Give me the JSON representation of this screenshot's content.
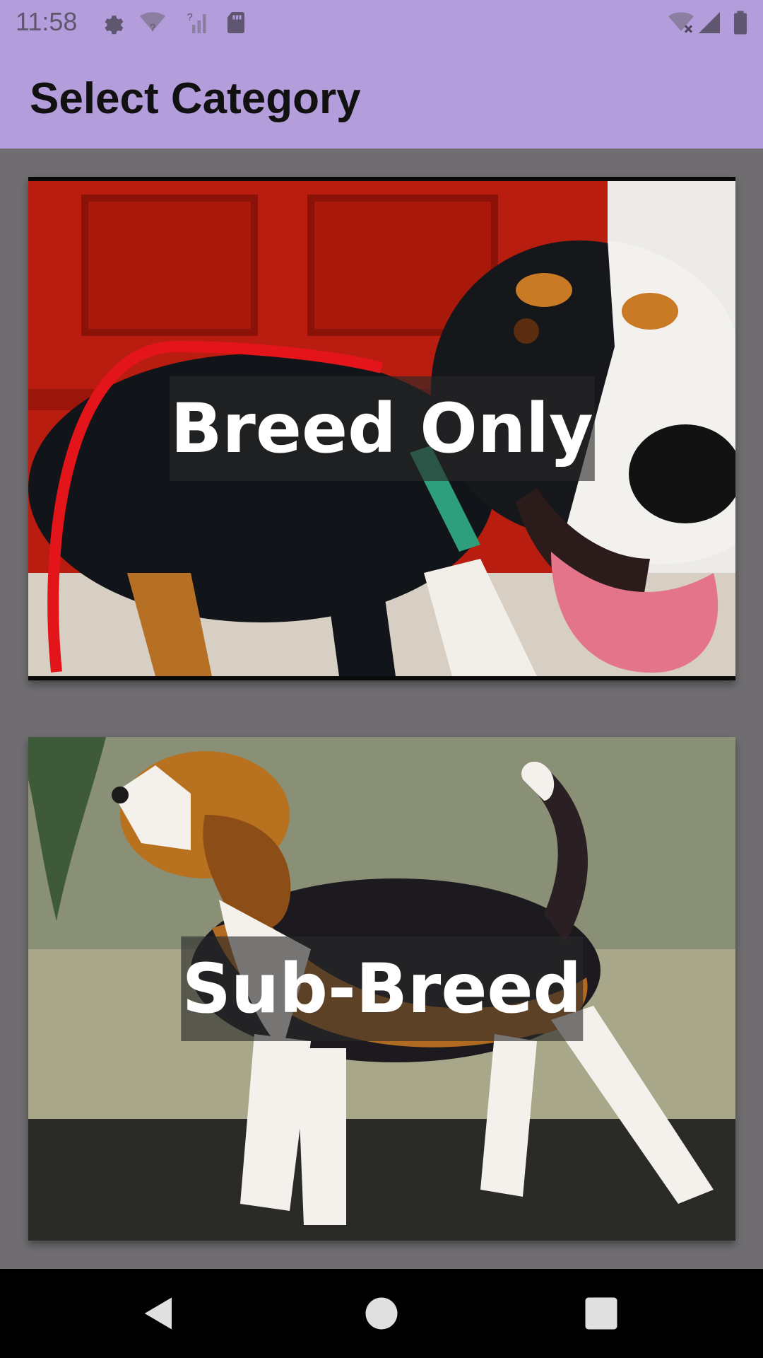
{
  "status_bar": {
    "time": "11:58",
    "left_icons": [
      "settings-icon",
      "wifi-unknown-icon",
      "signal-unknown-icon",
      "sd-card-icon"
    ],
    "right_icons": [
      "wifi-off-icon",
      "cell-signal-icon",
      "battery-icon"
    ]
  },
  "app_bar": {
    "title": "Select Category"
  },
  "categories": [
    {
      "label": "Breed Only",
      "image": "tricolor-hound-dog-photo"
    },
    {
      "label": "Sub-Breed",
      "image": "beagle-standing-photo"
    }
  ],
  "nav_bar": {
    "buttons": [
      "back-icon",
      "home-icon",
      "recents-icon"
    ]
  },
  "colors": {
    "app_bar": "#b39ddb",
    "background": "#6f6d70",
    "nav_bar": "#000000"
  }
}
